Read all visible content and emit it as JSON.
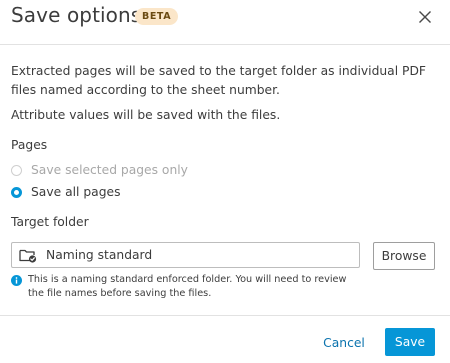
{
  "dialog": {
    "title": "Save options",
    "badge": "BETA",
    "close_icon": "close-icon"
  },
  "description": {
    "line1": "Extracted pages will be saved to the target folder as individual PDF files named according to the sheet number.",
    "line2": "Attribute values will be saved with the files."
  },
  "pages": {
    "label": "Pages",
    "options": [
      {
        "label": "Save selected pages only",
        "selected": false,
        "disabled": true
      },
      {
        "label": "Save all pages",
        "selected": true,
        "disabled": false
      }
    ]
  },
  "target_folder": {
    "label": "Target folder",
    "value": "Naming standard",
    "folder_icon": "naming-standard-folder-icon",
    "browse_label": "Browse",
    "info_icon": "info-icon",
    "info_text": "This is a naming standard enforced folder. You will need to review the file names before saving the files."
  },
  "footer": {
    "cancel_label": "Cancel",
    "save_label": "Save"
  },
  "colors": {
    "accent": "#0696d7",
    "link": "#0b73ae",
    "badge_bg": "#fbe6c9",
    "text": "#3c3c3c"
  }
}
